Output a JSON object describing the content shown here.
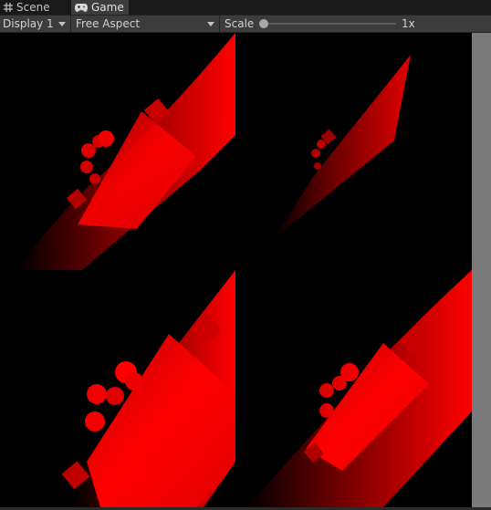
{
  "tabs": [
    {
      "label": "Scene",
      "icon": "grid-icon",
      "active": false
    },
    {
      "label": "Game",
      "icon": "gamepad-icon",
      "active": true
    }
  ],
  "toolbar": {
    "display": "Display 1",
    "aspect": "Free Aspect",
    "scale_label": "Scale",
    "scale_value": "1x",
    "scale_level": 0.0
  },
  "colors": {
    "object_red": "#ff0000",
    "viewport_background": "#000000"
  },
  "viewport": {
    "quadrants": [
      "camera-top-left",
      "camera-top-right",
      "camera-bottom-left",
      "camera-bottom-right"
    ]
  }
}
